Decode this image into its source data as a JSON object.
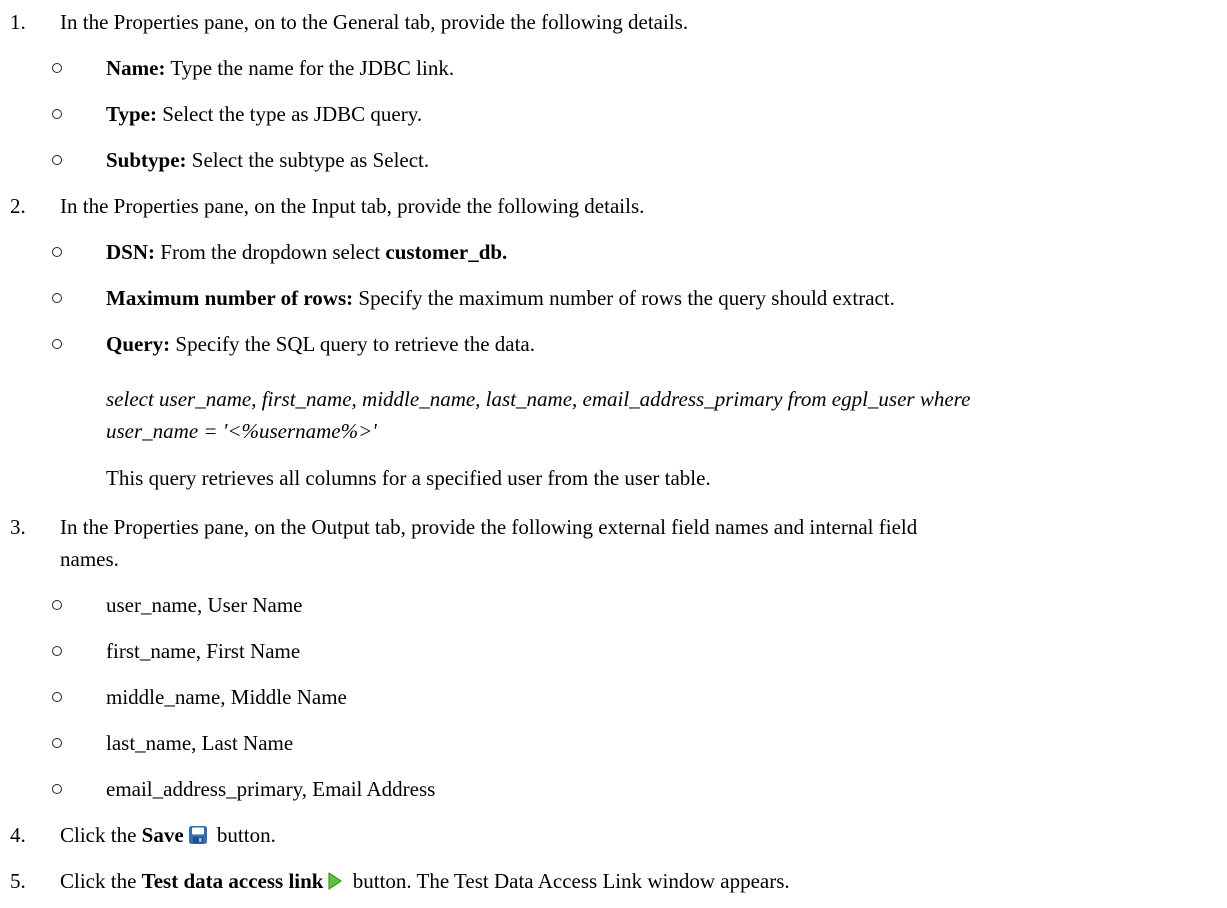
{
  "steps": [
    {
      "number": "1.",
      "text": "In the Properties pane, on to the General tab, provide the following details.",
      "bullets": [
        {
          "label": "Name:",
          "text": " Type the name for the JDBC link."
        },
        {
          "label": "Type:",
          "text": " Select the type as JDBC query."
        },
        {
          "label": "Subtype:",
          "text": " Select the subtype as Select."
        }
      ]
    },
    {
      "number": "2.",
      "text": "In the Properties pane, on the Input tab, provide the following details.",
      "bullets": [
        {
          "label": "DSN:",
          "text": " From the dropdown select ",
          "bold_value": "customer_db."
        },
        {
          "label": "Maximum number of rows:",
          "text": " Specify the maximum number of rows the query should extract."
        },
        {
          "label": "Query:",
          "text": " Specify the SQL query to retrieve the data."
        }
      ],
      "query_line1": "select user_name,  first_name, middle_name, last_name, email_address_primary from egpl_user where",
      "query_line2": "user_name = '<%username%>'",
      "query_note": "This query retrieves all columns for a specified user from the user table."
    },
    {
      "number": "3.",
      "text_line1": "In the Properties pane, on the Output tab, provide the following external field names and internal field",
      "text_line2": "names.",
      "bullets": [
        {
          "text": "user_name, User Name"
        },
        {
          "text": "first_name, First Name"
        },
        {
          "text": "middle_name, Middle Name"
        },
        {
          "text": "last_name, Last Name"
        },
        {
          "text": "email_address_primary, Email Address"
        }
      ]
    },
    {
      "number": "4.",
      "pre": "Click the ",
      "bold": "Save",
      "post": " button.",
      "icon": "save-icon"
    },
    {
      "number": "5.",
      "pre": "Click the ",
      "bold": "Test data access link",
      "post": " button. The Test Data Access Link window appears.",
      "icon": "play-icon"
    }
  ],
  "colors": {
    "save_icon": "#2f6db5",
    "play_icon": "#5cc33a"
  }
}
